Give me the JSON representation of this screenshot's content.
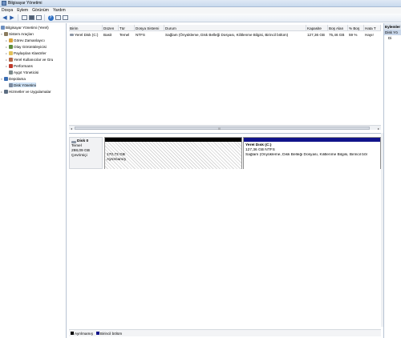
{
  "window": {
    "title": "Bilgisayar Yönetimi"
  },
  "menu": [
    "Dosya",
    "Eylem",
    "Görünüm",
    "Yardım"
  ],
  "toolbar": {
    "back_icon": "back-arrow-icon",
    "forward_icon": "forward-arrow-icon",
    "help_label": "?"
  },
  "tree": [
    {
      "label": "Bilgisayar Yönetimi (Yerel)",
      "icon": "computer-icon",
      "expander": "",
      "selected": false
    },
    {
      "label": "Sistem Araçları",
      "icon": "tools-icon",
      "expander": "▿",
      "selected": false
    },
    {
      "label": "Görev Zamanlayıcı",
      "icon": "clock-icon",
      "expander": "▹",
      "selected": false
    },
    {
      "label": "Olay Görüntüleyicisi",
      "icon": "event-viewer-icon",
      "expander": "▹",
      "selected": false
    },
    {
      "label": "Paylaşılan Klasörler",
      "icon": "shared-folder-icon",
      "expander": "▹",
      "selected": false
    },
    {
      "label": "Yerel Kullanıcılar ve Gru",
      "icon": "users-icon",
      "expander": "▹",
      "selected": false
    },
    {
      "label": "Performans",
      "icon": "performance-icon",
      "expander": "▹",
      "selected": false
    },
    {
      "label": "Aygıt Yöneticisi",
      "icon": "device-manager-icon",
      "expander": "",
      "selected": false
    },
    {
      "label": "Depolama",
      "icon": "storage-icon",
      "expander": "▿",
      "selected": false
    },
    {
      "label": "Disk Yönetimi",
      "icon": "disk-management-icon",
      "expander": "",
      "selected": true
    },
    {
      "label": "Hizmetler ve Uygulamalar",
      "icon": "services-icon",
      "expander": "▹",
      "selected": false
    }
  ],
  "volume_table": {
    "columns": [
      "Birim",
      "Düzen",
      "Tür",
      "Dosya Sistemi",
      "Durum",
      "Kapasite",
      "Boş Alan",
      "% Boş",
      "Hata T"
    ],
    "rows": [
      [
        "Yerel Disk (C:)",
        "Basit",
        "Temel",
        "NTFS",
        "Sağlam (Önyükleme, Disk Belleği Dosyası, Kilitlenme Bilgisi, Birincil bölüm)",
        "127,36 GB",
        "75,46 GB",
        "59 %",
        "Hayır"
      ]
    ]
  },
  "disk": {
    "name": "Disk 0",
    "type": "Temel",
    "size": "298,09 GB",
    "status": "Çevrimiçi"
  },
  "partitions": [
    {
      "size": "170,73 GB",
      "label": "Ayrılmamış",
      "name": "",
      "color": "#000000"
    },
    {
      "name": "Yerel Disk  (C:)",
      "size": "127,36 GB NTFS",
      "label": "Sağlam (Önyükleme, Disk Belleği Dosyası, Kilitlenme Bilgisi, Birincil böl",
      "color": "#11148a"
    }
  ],
  "legend": [
    {
      "label": "Ayrılmamış",
      "color": "#000000"
    },
    {
      "label": "Birincil bölüm",
      "color": "#11148a"
    }
  ],
  "actions": {
    "header": "Eylemler",
    "section": "Disk Yö",
    "item": "Di"
  },
  "scroll": {
    "left_arrow": "◂",
    "right_arrow": "▸",
    "grip": "III"
  }
}
